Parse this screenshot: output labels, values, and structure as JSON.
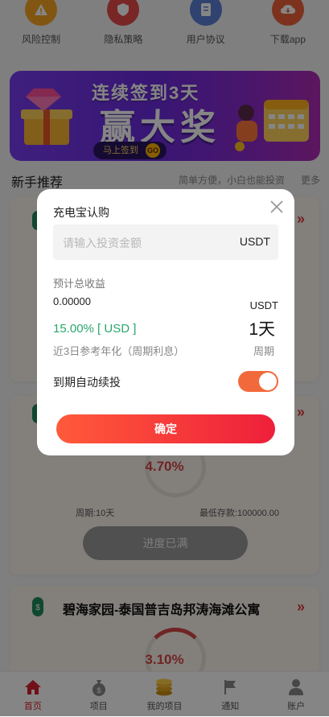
{
  "quick_links": [
    {
      "label": "风险控制",
      "icon": "warning-icon",
      "color": "#f5a623"
    },
    {
      "label": "隐私策略",
      "icon": "shield-icon",
      "color": "#e84a4a"
    },
    {
      "label": "用户协议",
      "icon": "document-icon",
      "color": "#5a7fd6"
    },
    {
      "label": "下载app",
      "icon": "cloud-download-icon",
      "color": "#f0603a"
    }
  ],
  "banner": {
    "title": "连续签到3天",
    "big_text": "赢大奖",
    "button_text": "马上签到",
    "go_text": "GO"
  },
  "section": {
    "title": "新手推荐",
    "hint": "简单方便，小白也能投资",
    "more": "更多"
  },
  "cards": [
    {
      "percent": "",
      "period": "",
      "min_deposit": "",
      "status": ""
    },
    {
      "percent": "4.70%",
      "period": "周期:10天",
      "min_deposit": "最低存款:100000.00",
      "status": "进度已满"
    },
    {
      "title": "碧海家园-泰国普吉岛邦涛海滩公寓",
      "percent": "3.10%"
    }
  ],
  "nav": [
    {
      "label": "首页",
      "icon": "home-icon",
      "active": true
    },
    {
      "label": "项目",
      "icon": "money-bag-icon",
      "active": false
    },
    {
      "label": "我的项目",
      "icon": "coins-icon",
      "active": false
    },
    {
      "label": "通知",
      "icon": "flag-icon",
      "active": false
    },
    {
      "label": "账户",
      "icon": "user-icon",
      "active": false
    }
  ],
  "modal": {
    "title": "充电宝认购",
    "amount_placeholder": "请输入投资金额",
    "amount_unit": "USDT",
    "total_label": "预计总收益",
    "total_value": "0.00000",
    "total_unit": "USDT",
    "rate": "15.00% [ USD ]",
    "days": "1天",
    "rate_note": "近3日参考年化（周期利息）",
    "period_label": "周期",
    "auto_label": "到期自动续投",
    "auto_on": true,
    "confirm_label": "确定"
  },
  "colors": {
    "accent": "#ee1f3a",
    "toggle_on": "#f26a3c",
    "rate_green": "#2aa66d",
    "nav_active": "#d6222e"
  }
}
